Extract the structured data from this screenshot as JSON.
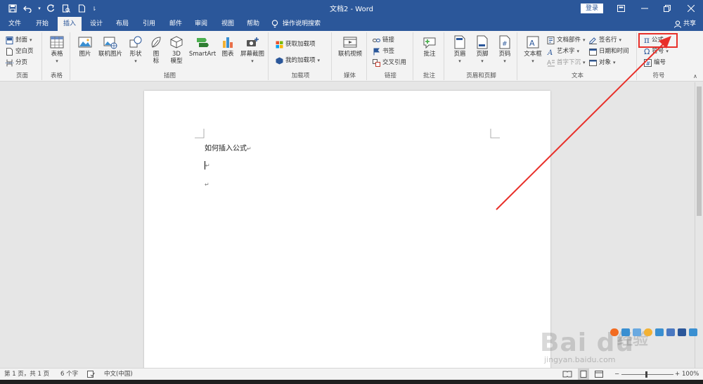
{
  "title_bar": {
    "document_title": "文档2 - Word",
    "login_label": "登录"
  },
  "tabs": [
    {
      "label": "文件"
    },
    {
      "label": "开始"
    },
    {
      "label": "插入",
      "active": true
    },
    {
      "label": "设计"
    },
    {
      "label": "布局"
    },
    {
      "label": "引用"
    },
    {
      "label": "邮件"
    },
    {
      "label": "审阅"
    },
    {
      "label": "视图"
    },
    {
      "label": "帮助"
    }
  ],
  "tell_me": "操作说明搜索",
  "share_label": "共享",
  "ribbon": {
    "pages": {
      "items": [
        "封面",
        "空白页",
        "分页"
      ],
      "label": "页面"
    },
    "tables": {
      "items": [
        "表格"
      ],
      "label": "表格"
    },
    "illustrations": {
      "items": [
        "图片",
        "联机图片",
        "形状",
        "图",
        "标",
        "3D",
        "模型",
        "SmartArt",
        "图表",
        "屏幕截图"
      ],
      "label": "插图"
    },
    "addins": {
      "items": [
        "获取加载项",
        "我的加载项"
      ],
      "label": "加载项"
    },
    "media": {
      "items": [
        "联机视频"
      ],
      "label": "媒体"
    },
    "links": {
      "items": [
        "链接",
        "书签",
        "交叉引用"
      ],
      "label": "链接"
    },
    "comments": {
      "items": [
        "批注"
      ],
      "label": "批注"
    },
    "header_footer": {
      "items": [
        "页眉",
        "页脚",
        "页码"
      ],
      "label": "页眉和页脚"
    },
    "text": {
      "items": [
        "文本框",
        "文档部件",
        "艺术字",
        "首字下沉",
        "签名行",
        "日期和时间",
        "对象"
      ],
      "label": "文本"
    },
    "symbols": {
      "items": [
        "公式",
        "符号",
        "编号"
      ],
      "label": "符号"
    }
  },
  "document": {
    "lines": [
      "如何插入公式"
    ],
    "para_mark": "↵"
  },
  "status_bar": {
    "page": "第 1 页，共 1 页",
    "words": "6 个字",
    "language": "中文(中国)",
    "zoom": "100%"
  },
  "watermark": {
    "logo": "Bai du",
    "sub": "jingyan.baidu.com",
    "jingyan": "经验"
  },
  "colors": {
    "title_bar": "#2b579a",
    "ribbon_bg": "#f3f3f3",
    "annotation_red": "#e8302a"
  }
}
